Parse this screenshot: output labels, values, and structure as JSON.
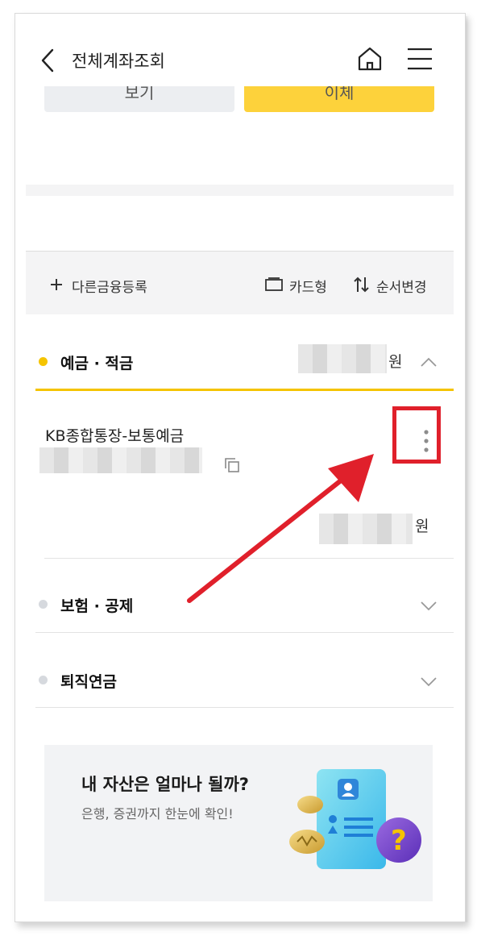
{
  "header": {
    "title": "전체계좌조회"
  },
  "top_buttons": {
    "left_label": "보기",
    "right_label": "이체"
  },
  "toolbar": {
    "add_label": "다른금융등록",
    "card_label": "카드형",
    "order_label": "순서변경"
  },
  "sections": [
    {
      "title": "예금 · 적금",
      "currency": "원",
      "expanded": true,
      "dot_color": "#f5c400"
    },
    {
      "title": "보험 · 공제",
      "expanded": false,
      "dot_color": "#d6d9de"
    },
    {
      "title": "퇴직연금",
      "expanded": false,
      "dot_color": "#d6d9de"
    }
  ],
  "account": {
    "name": "KB종합통장-보통예금",
    "currency": "원"
  },
  "banner": {
    "title": "내 자산은 얼마나 될까?",
    "subtitle": "은행, 증권까지 한눈에 확인!"
  },
  "colors": {
    "accent": "#fdd23b",
    "highlight": "#e0202b"
  }
}
